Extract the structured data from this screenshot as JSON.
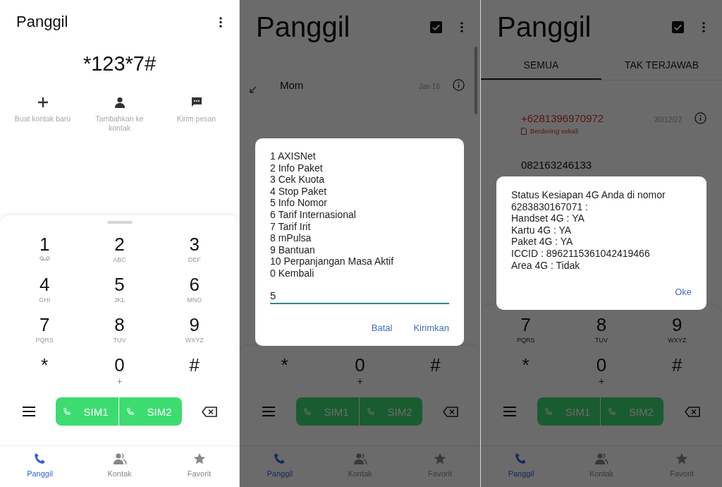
{
  "panels": [
    {
      "kind": "dialer",
      "title": "Panggil",
      "typed_number": "*123*7#",
      "quick_actions": [
        {
          "kind": "add",
          "label": "Buat kontak baru"
        },
        {
          "kind": "person",
          "label": "Tambahkan ke kontak"
        },
        {
          "kind": "message",
          "label": "Kirim pesan"
        }
      ],
      "keypad": [
        {
          "digit": "1",
          "voicemail": true
        },
        {
          "digit": "2",
          "sub": "ABC"
        },
        {
          "digit": "3",
          "sub": "DEF"
        },
        {
          "digit": "4",
          "sub": "GHI"
        },
        {
          "digit": "5",
          "sub": "JKL"
        },
        {
          "digit": "6",
          "sub": "MNO"
        },
        {
          "digit": "7",
          "sub": "PQRS"
        },
        {
          "digit": "8",
          "sub": "TUV"
        },
        {
          "digit": "9",
          "sub": "WXYZ"
        },
        {
          "digit": "*"
        },
        {
          "digit": "0",
          "sub": "+"
        },
        {
          "digit": "#"
        }
      ],
      "sim_buttons": [
        "SIM1",
        "SIM2"
      ],
      "nav": [
        {
          "kind": "phone",
          "label": "Panggil",
          "selected": true
        },
        {
          "kind": "contacts",
          "label": "Kontak",
          "selected": false
        },
        {
          "kind": "star",
          "label": "Favorit",
          "selected": false
        }
      ]
    },
    {
      "kind": "log",
      "title": "Panggil",
      "call_log": [
        {
          "name": "Mom",
          "date": "Jan 16",
          "missed": false
        }
      ],
      "keypad": [
        {
          "digit": "*"
        },
        {
          "digit": "0",
          "sub": "+"
        },
        {
          "digit": "#"
        }
      ],
      "sim_buttons": [
        "SIM1",
        "SIM2"
      ],
      "nav": [
        {
          "kind": "phone",
          "label": "Panggil",
          "selected": true
        },
        {
          "kind": "contacts",
          "label": "Kontak",
          "selected": false
        },
        {
          "kind": "star",
          "label": "Favorit",
          "selected": false
        }
      ],
      "dialog": {
        "kind": "menu",
        "lines": [
          "1 AXISNet",
          "2 Info Paket",
          "3 Cek Kuota",
          "4 Stop Paket",
          "5 Info Nomor",
          "6 Tarif Internasional",
          "7 Tarif Irit",
          "8 mPulsa",
          "9 Bantuan",
          "10 Perpanjangan Masa Aktif",
          "0 Kembali"
        ],
        "input_value": "5",
        "buttons": [
          "Batal",
          "Kirimkan"
        ]
      }
    },
    {
      "kind": "log",
      "title": "Panggil",
      "tabs": [
        {
          "label": "SEMUA",
          "selected": true
        },
        {
          "label": "TAK TERJAWAB",
          "selected": false
        }
      ],
      "call_log": [
        {
          "name": "+6281396970972",
          "note": "Berdering sekali",
          "date": "30/12/22",
          "missed": true
        },
        {
          "name": "082163246133",
          "missed": false
        }
      ],
      "keypad": [
        {
          "digit": "7",
          "sub": "PQRS"
        },
        {
          "digit": "8",
          "sub": "TUV"
        },
        {
          "digit": "9",
          "sub": "WXYZ"
        },
        {
          "digit": "*"
        },
        {
          "digit": "0",
          "sub": "+"
        },
        {
          "digit": "#"
        }
      ],
      "sim_buttons": [
        "SIM1",
        "SIM2"
      ],
      "nav": [
        {
          "kind": "phone",
          "label": "Panggil",
          "selected": true
        },
        {
          "kind": "contacts",
          "label": "Kontak",
          "selected": false
        },
        {
          "kind": "star",
          "label": "Favorit",
          "selected": false
        }
      ],
      "dialog": {
        "kind": "result",
        "lines": [
          "Status Kesiapan 4G Anda di nomor",
          "6283830167071 :",
          "Handset 4G : YA",
          "Kartu 4G : YA",
          "Paket 4G : YA",
          "ICCID : 8962115361042419466",
          "Area 4G : Tidak"
        ],
        "buttons": [
          "Oke"
        ]
      }
    }
  ]
}
